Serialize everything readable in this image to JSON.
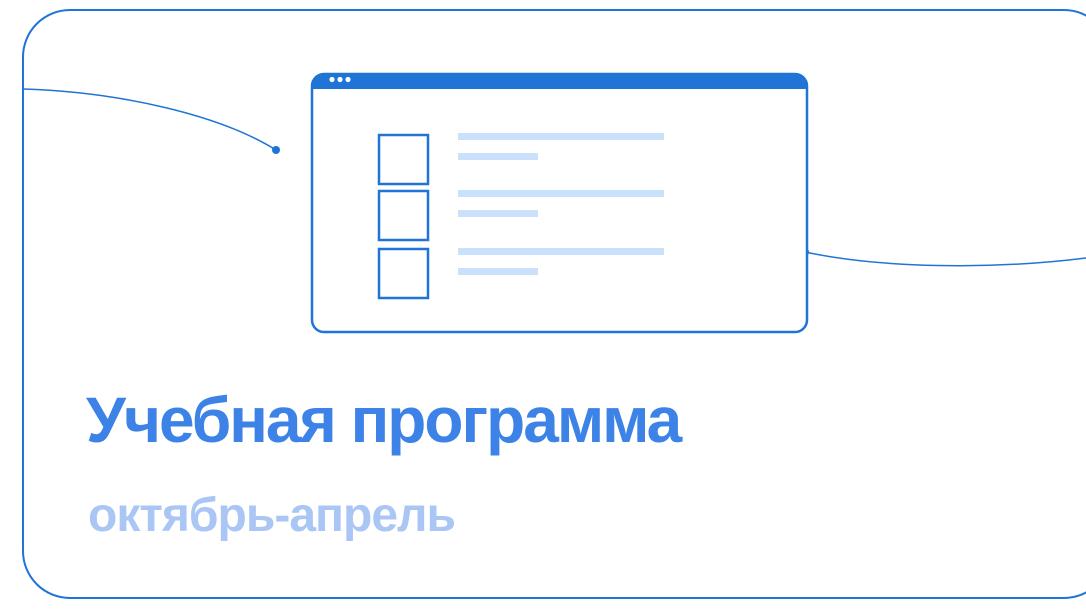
{
  "heading": {
    "title": "Учебная программа",
    "subtitle": "октябрь-апрель"
  },
  "illustration": {
    "icon": "checklist-window-icon",
    "checklist_rows": 3
  },
  "colors": {
    "accent": "#1f74d6",
    "title": "#3d82e6",
    "subtitle": "#a9c6f4",
    "line_light": "#c9e1fa"
  }
}
